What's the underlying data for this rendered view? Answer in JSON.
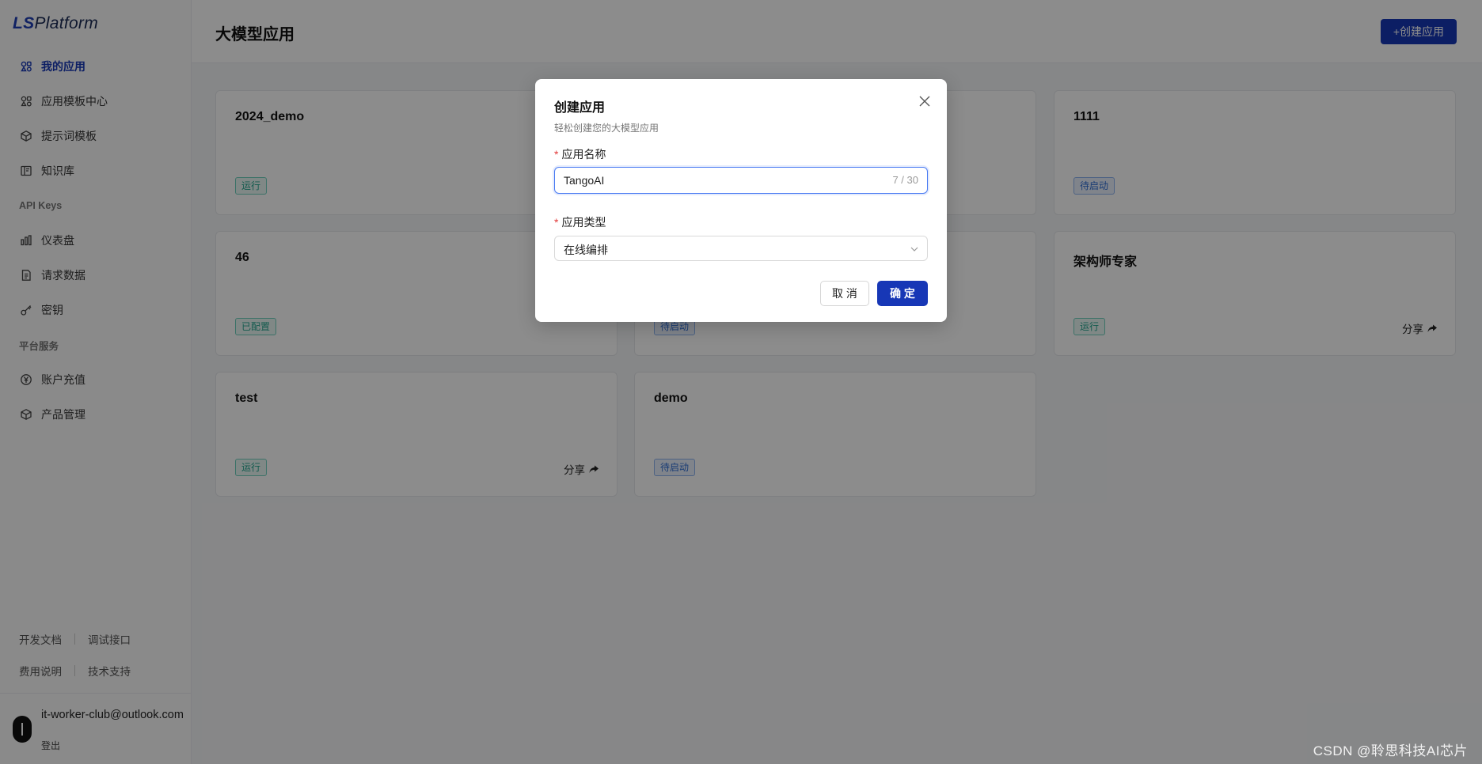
{
  "sidebar": {
    "logo_mark": "LS",
    "logo_text": "Platform",
    "nav": [
      {
        "label": "我的应用",
        "icon": "apps-icon",
        "active": true
      },
      {
        "label": "应用模板中心",
        "icon": "template-icon"
      },
      {
        "label": "提示词模板",
        "icon": "cube-icon"
      },
      {
        "label": "知识库",
        "icon": "book-icon"
      }
    ],
    "section_api": "API Keys",
    "nav_api": [
      {
        "label": "仪表盘",
        "icon": "bar-chart-icon"
      },
      {
        "label": "请求数据",
        "icon": "document-icon"
      },
      {
        "label": "密钥",
        "icon": "key-icon"
      }
    ],
    "section_platform": "平台服务",
    "nav_platform": [
      {
        "label": "账户充值",
        "icon": "currency-icon"
      },
      {
        "label": "产品管理",
        "icon": "cube-icon"
      }
    ],
    "footer_links": [
      "开发文档",
      "调试接口",
      "费用说明",
      "技术支持"
    ],
    "user_email": "it-worker-club@outlook.com",
    "logout": "登出"
  },
  "header": {
    "title": "大模型应用",
    "create_button": "+创建应用"
  },
  "cards": [
    {
      "title": "2024_demo",
      "status": "运行",
      "status_type": "run"
    },
    {
      "title": "",
      "status": "",
      "status_type": ""
    },
    {
      "title": "1111",
      "status": "待启动",
      "status_type": "wait"
    },
    {
      "title": "46",
      "status": "已配置",
      "status_type": "run"
    },
    {
      "title": "",
      "status": "待启动",
      "status_type": "wait"
    },
    {
      "title": "架构师专家",
      "status": "运行",
      "status_type": "run",
      "share": "分享"
    },
    {
      "title": "test",
      "status": "运行",
      "status_type": "run",
      "share": "分享"
    },
    {
      "title": "demo",
      "status": "待启动",
      "status_type": "wait"
    }
  ],
  "modal": {
    "title": "创建应用",
    "subtitle": "轻松创建您的大模型应用",
    "name_label": "应用名称",
    "name_value": "TangoAI",
    "name_counter": "7 / 30",
    "type_label": "应用类型",
    "type_value": "在线编排",
    "cancel": "取 消",
    "ok": "确 定"
  },
  "watermark": "CSDN @聆思科技AI芯片",
  "colors": {
    "primary": "#1737b6",
    "run_badge": "#24a58e",
    "wait_badge": "#2f6dd4",
    "required": "#e23b3b"
  }
}
